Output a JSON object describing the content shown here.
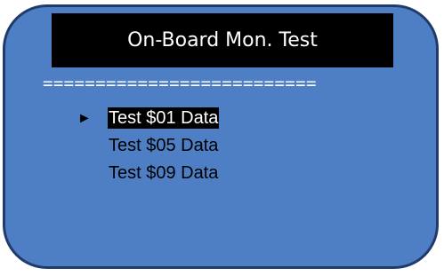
{
  "screen": {
    "title": "On-Board Mon. Test",
    "separator": "=========================="
  },
  "menu": {
    "selector_glyph": "►",
    "items": [
      {
        "label": "Test $01 Data",
        "selected": true
      },
      {
        "label": "Test $05 Data",
        "selected": false
      },
      {
        "label": "Test $09 Data",
        "selected": false
      }
    ]
  },
  "colors": {
    "screen_background": "#4e7fc4",
    "screen_border": "#1f3b6b",
    "title_background": "#000000",
    "highlight_background": "#000000",
    "highlight_text": "#ffffff"
  }
}
